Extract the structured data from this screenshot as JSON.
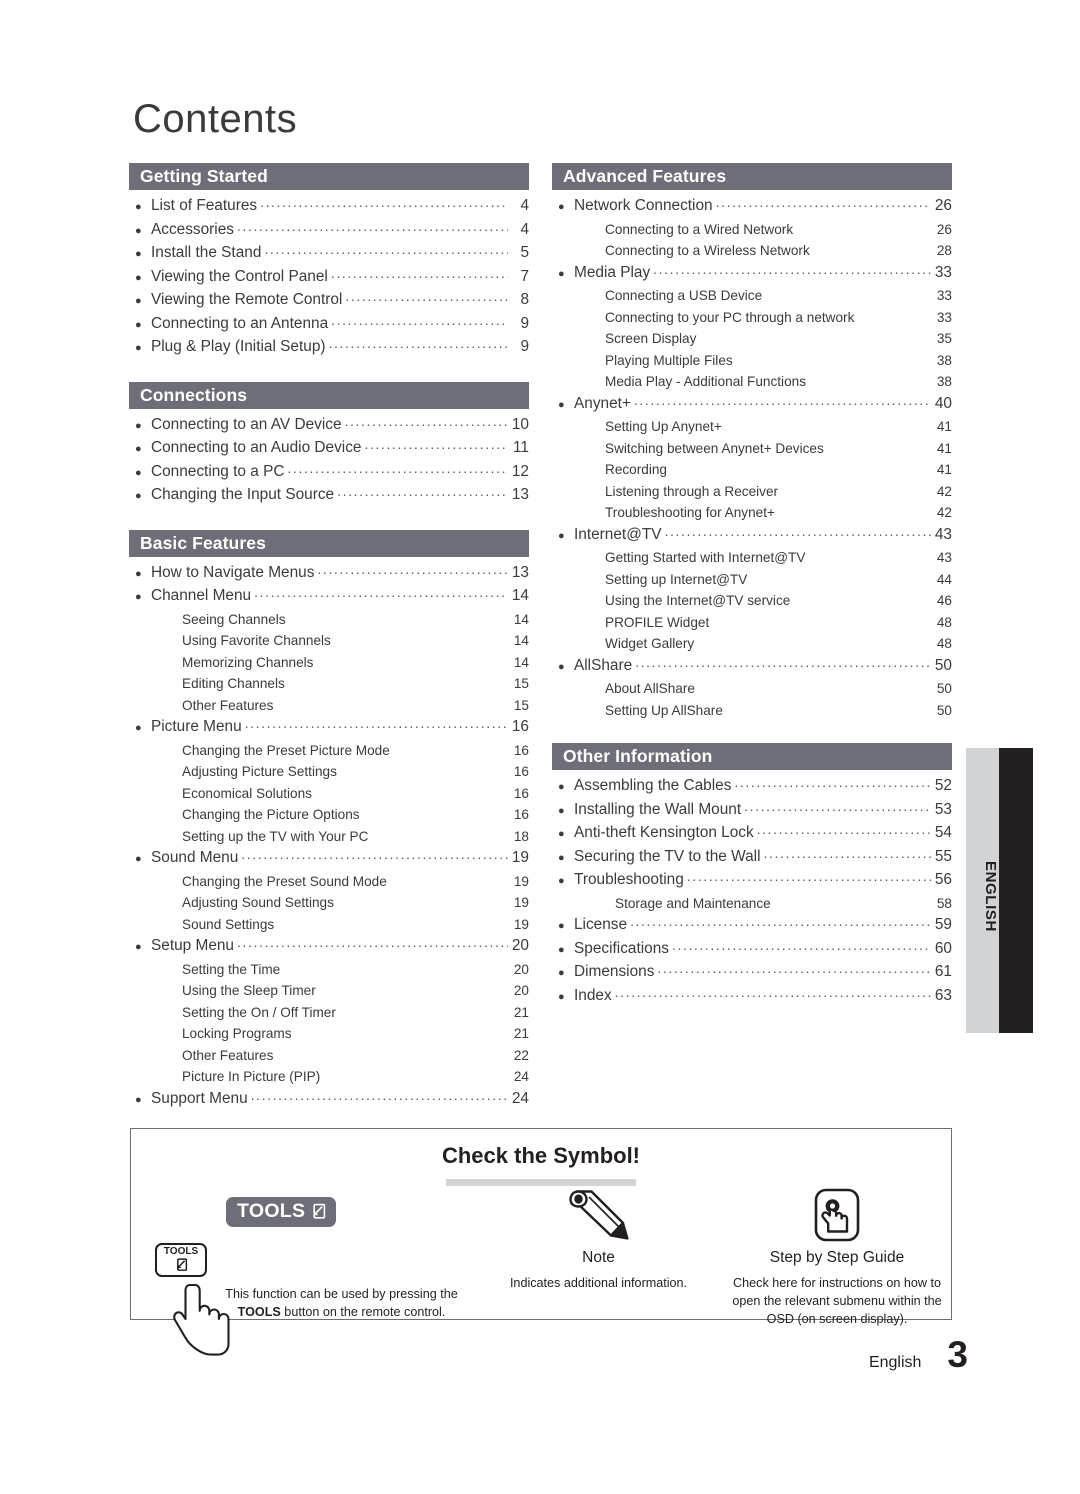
{
  "page_title": "Contents",
  "colors": {
    "section_header_bg": "#6d6e77",
    "side_tab_gray": "#d2d3d5",
    "side_tab_black": "#231f20",
    "text": "#3b3b3d"
  },
  "side_tab": {
    "label": "ENGLISH"
  },
  "footer": {
    "language": "English",
    "page_number": "3"
  },
  "columns": {
    "left": [
      {
        "header": "Getting Started",
        "entries": [
          {
            "level": 1,
            "text": "List of Features",
            "page": "4"
          },
          {
            "level": 1,
            "text": "Accessories",
            "page": "4"
          },
          {
            "level": 1,
            "text": "Install the Stand",
            "page": "5"
          },
          {
            "level": 1,
            "text": "Viewing the Control Panel",
            "page": "7"
          },
          {
            "level": 1,
            "text": "Viewing the Remote Control",
            "page": "8"
          },
          {
            "level": 1,
            "text": "Connecting to an Antenna",
            "page": "9"
          },
          {
            "level": 1,
            "text": "Plug & Play (Initial Setup)",
            "page": "9"
          }
        ]
      },
      {
        "header": "Connections",
        "entries": [
          {
            "level": 1,
            "text": "Connecting to an AV Device",
            "page": "10"
          },
          {
            "level": 1,
            "text": "Connecting to an Audio Device",
            "page": "11"
          },
          {
            "level": 1,
            "text": "Connecting to a PC",
            "page": "12"
          },
          {
            "level": 1,
            "text": "Changing the Input Source",
            "page": "13"
          }
        ]
      },
      {
        "header": "Basic Features",
        "entries": [
          {
            "level": 1,
            "text": "How to Navigate Menus",
            "page": "13"
          },
          {
            "level": 1,
            "text": "Channel Menu",
            "page": "14"
          },
          {
            "level": 2,
            "text": "Seeing Channels",
            "page": "14"
          },
          {
            "level": 2,
            "text": "Using Favorite Channels",
            "page": "14"
          },
          {
            "level": 2,
            "text": "Memorizing Channels",
            "page": "14"
          },
          {
            "level": 2,
            "text": "Editing Channels",
            "page": "15"
          },
          {
            "level": 2,
            "text": "Other Features",
            "page": "15"
          },
          {
            "level": 1,
            "text": "Picture Menu",
            "page": "16"
          },
          {
            "level": 2,
            "text": "Changing the Preset Picture Mode",
            "page": "16"
          },
          {
            "level": 2,
            "text": "Adjusting Picture Settings",
            "page": "16"
          },
          {
            "level": 2,
            "text": "Economical Solutions",
            "page": "16"
          },
          {
            "level": 2,
            "text": "Changing the Picture Options",
            "page": "16"
          },
          {
            "level": 2,
            "text": "Setting up the TV with Your PC",
            "page": "18"
          },
          {
            "level": 1,
            "text": "Sound Menu",
            "page": "19"
          },
          {
            "level": 2,
            "text": "Changing the Preset Sound Mode",
            "page": "19"
          },
          {
            "level": 2,
            "text": "Adjusting Sound Settings",
            "page": "19"
          },
          {
            "level": 2,
            "text": "Sound Settings",
            "page": "19"
          },
          {
            "level": 1,
            "text": "Setup Menu",
            "page": "20"
          },
          {
            "level": 2,
            "text": "Setting the Time",
            "page": "20"
          },
          {
            "level": 2,
            "text": "Using the Sleep Timer",
            "page": "20"
          },
          {
            "level": 2,
            "text": "Setting the On / Off Timer",
            "page": "21"
          },
          {
            "level": 2,
            "text": "Locking Programs",
            "page": "21"
          },
          {
            "level": 2,
            "text": "Other Features",
            "page": "22"
          },
          {
            "level": 2,
            "text": "Picture In Picture (PIP)",
            "page": "24"
          },
          {
            "level": 1,
            "text": "Support Menu",
            "page": "24"
          }
        ]
      }
    ],
    "right": [
      {
        "header": "Advanced Features",
        "entries": [
          {
            "level": 1,
            "text": "Network Connection",
            "page": "26"
          },
          {
            "level": 2,
            "text": "Connecting to a Wired Network",
            "page": "26"
          },
          {
            "level": 2,
            "text": "Connecting to a Wireless Network",
            "page": "28"
          },
          {
            "level": 1,
            "text": "Media Play",
            "page": "33"
          },
          {
            "level": 2,
            "text": "Connecting a USB Device",
            "page": "33"
          },
          {
            "level": 2,
            "text": "Connecting to your PC through a network",
            "page": "33"
          },
          {
            "level": 2,
            "text": "Screen Display",
            "page": "35"
          },
          {
            "level": 2,
            "text": "Playing Multiple Files",
            "page": "38"
          },
          {
            "level": 2,
            "text": "Media Play - Additional Functions",
            "page": "38"
          },
          {
            "level": 1,
            "text": "Anynet+",
            "page": "40"
          },
          {
            "level": 2,
            "text": "Setting Up Anynet+",
            "page": "41"
          },
          {
            "level": 2,
            "text": "Switching between Anynet+ Devices",
            "page": "41"
          },
          {
            "level": 2,
            "text": "Recording",
            "page": "41"
          },
          {
            "level": 2,
            "text": "Listening through a Receiver",
            "page": "42"
          },
          {
            "level": 2,
            "text": "Troubleshooting for Anynet+",
            "page": "42"
          },
          {
            "level": 1,
            "text": "Internet@TV",
            "page": "43"
          },
          {
            "level": 2,
            "text": "Getting Started with Internet@TV",
            "page": "43"
          },
          {
            "level": 2,
            "text": "Setting up Internet@TV",
            "page": "44"
          },
          {
            "level": 2,
            "text": "Using the Internet@TV service",
            "page": "46"
          },
          {
            "level": 2,
            "text": "PROFILE Widget",
            "page": "48"
          },
          {
            "level": 2,
            "text": "Widget Gallery",
            "page": "48"
          },
          {
            "level": 1,
            "text": "AllShare",
            "page": "50"
          },
          {
            "level": 2,
            "text": "About AllShare",
            "page": "50"
          },
          {
            "level": 2,
            "text": "Setting Up AllShare",
            "page": "50"
          }
        ]
      },
      {
        "header": "Other Information",
        "entries": [
          {
            "level": 1,
            "text": "Assembling the Cables",
            "page": "52"
          },
          {
            "level": 1,
            "text": "Installing the Wall Mount",
            "page": "53"
          },
          {
            "level": 1,
            "text": "Anti-theft Kensington Lock",
            "page": "54"
          },
          {
            "level": 1,
            "text": "Securing the TV to the Wall",
            "page": "55"
          },
          {
            "level": 1,
            "text": "Troubleshooting",
            "page": "56"
          },
          {
            "level": 2,
            "text": "Storage and Maintenance",
            "page": "58",
            "extra_indent": true
          },
          {
            "level": 1,
            "text": "License",
            "page": "59"
          },
          {
            "level": 1,
            "text": "Specifications",
            "page": "60"
          },
          {
            "level": 1,
            "text": "Dimensions",
            "page": "61"
          },
          {
            "level": 1,
            "text": "Index",
            "page": "63"
          }
        ]
      }
    ]
  },
  "symbol_box": {
    "title": "Check the Symbol!",
    "items": [
      {
        "icon": "tools-chip-icon",
        "chip_label": "TOOLS",
        "remote_key_label": "TOOLS",
        "label": "",
        "description_pre": "This function can be used by pressing the ",
        "description_bold": "TOOLS",
        "description_post": " button on the remote control."
      },
      {
        "icon": "pencil-icon",
        "label": "Note",
        "description": "Indicates additional information."
      },
      {
        "icon": "hand-pointer-icon",
        "label": "Step by Step Guide",
        "description": "Check here for instructions on how to open the relevant submenu within the OSD (on screen display)."
      }
    ]
  }
}
